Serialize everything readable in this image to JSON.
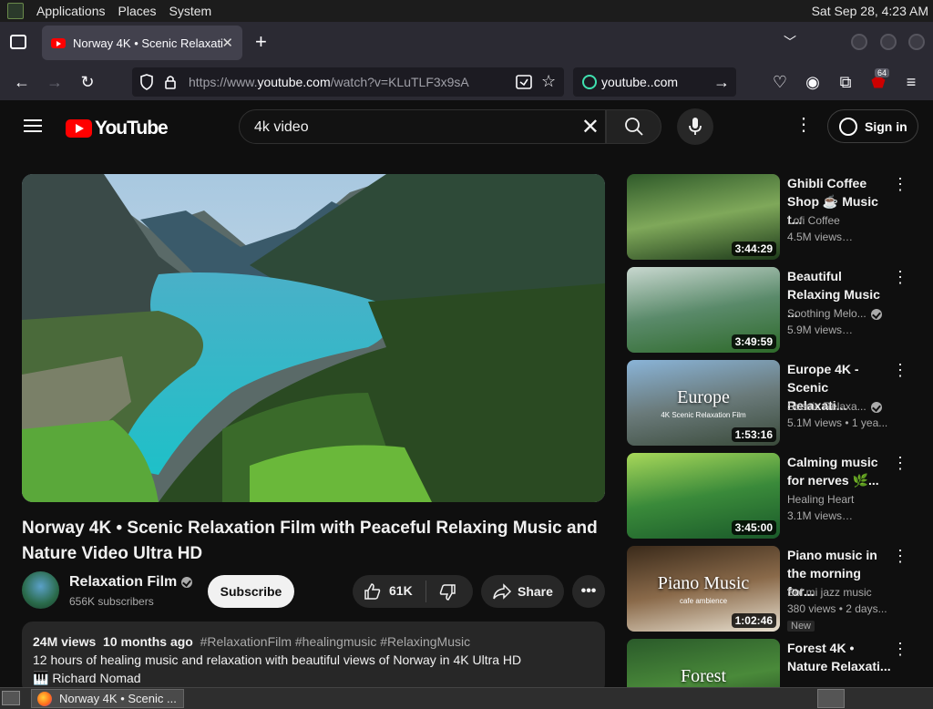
{
  "os_panel": {
    "menu": [
      "Applications",
      "Places",
      "System"
    ],
    "clock": "Sat Sep 28,  4:23 AM"
  },
  "browser": {
    "tab_title": "Norway 4K • Scenic Relaxati",
    "url_prefix": "https://www.",
    "url_domain": "youtube.com",
    "url_path": "/watch?v=KLuTLF3x9sA",
    "search_engine_text": "youtube..com",
    "extension_badge": "64"
  },
  "youtube": {
    "logo_text": "YouTube",
    "search_query": "4k video",
    "sign_in_label": "Sign in",
    "video": {
      "title": "Norway 4K • Scenic Relaxation Film with Peaceful Relaxing Music and Nature Video Ultra HD",
      "channel": "Relaxation Film",
      "subscribers": "656K subscribers",
      "subscribe_label": "Subscribe",
      "likes": "61K",
      "share_label": "Share",
      "views": "24M views",
      "age": "10 months ago",
      "tags": "#RelaxationFilm #healingmusic #RelaxingMusic",
      "description_line1": "12 hours of healing music and relaxation with beautiful views of Norway in 4K Ultra HD",
      "description_line2": "🎹 Richard Nomad"
    },
    "recommendations": [
      {
        "title": "Ghibli Coffee Shop ☕ Music t...",
        "channel": "Lofi Coffee",
        "views": "4.5M views…",
        "duration": "3:44:29",
        "verified": false,
        "new": false,
        "thumb_colors": [
          "#2f5a2a",
          "#7fa85a",
          "#1d3a1a"
        ]
      },
      {
        "title": "Beautiful Relaxing Music ...",
        "channel": "Soothing Melo...",
        "views": "5.9M views…",
        "duration": "3:49:59",
        "verified": true,
        "new": false,
        "thumb_colors": [
          "#c9d8d0",
          "#5a8a6a",
          "#2e6a2a"
        ]
      },
      {
        "title": "Europe 4K - Scenic Relaxati...",
        "channel": "Scenic Relaxa...",
        "views": "5.1M views  • 1 yea...",
        "duration": "1:53:16",
        "verified": true,
        "new": false,
        "thumb_colors": [
          "#8ab4d8",
          "#6a7a7a",
          "#3a4a3a"
        ],
        "overlay_text": "Europe",
        "overlay_sub": "4K Scenic Relaxation Film"
      },
      {
        "title": "Calming music for nerves 🌿...",
        "channel": "Healing Heart",
        "views": "3.1M views…",
        "duration": "3:45:00",
        "verified": false,
        "new": false,
        "thumb_colors": [
          "#a8d85a",
          "#3a8a3a",
          "#1a5a2a"
        ]
      },
      {
        "title": "Piano music in the morning for...",
        "channel": "Sol mi jazz music",
        "views": "380 views  • 2 days...",
        "duration": "1:02:46",
        "verified": false,
        "new": true,
        "new_label": "New",
        "thumb_colors": [
          "#3a2a1a",
          "#8a6a4a",
          "#e8e0d0"
        ],
        "overlay_text": "Piano Music",
        "overlay_sub": "cafe ambience"
      },
      {
        "title": "Forest 4K • Nature Relaxati...",
        "channel": "",
        "views": "",
        "duration": "",
        "verified": false,
        "new": false,
        "thumb_colors": [
          "#2a5a2a",
          "#4a8a3a",
          "#1a3a1a"
        ],
        "overlay_text": "Forest"
      }
    ]
  },
  "taskbar": {
    "window_title": "Norway 4K • Scenic ..."
  }
}
